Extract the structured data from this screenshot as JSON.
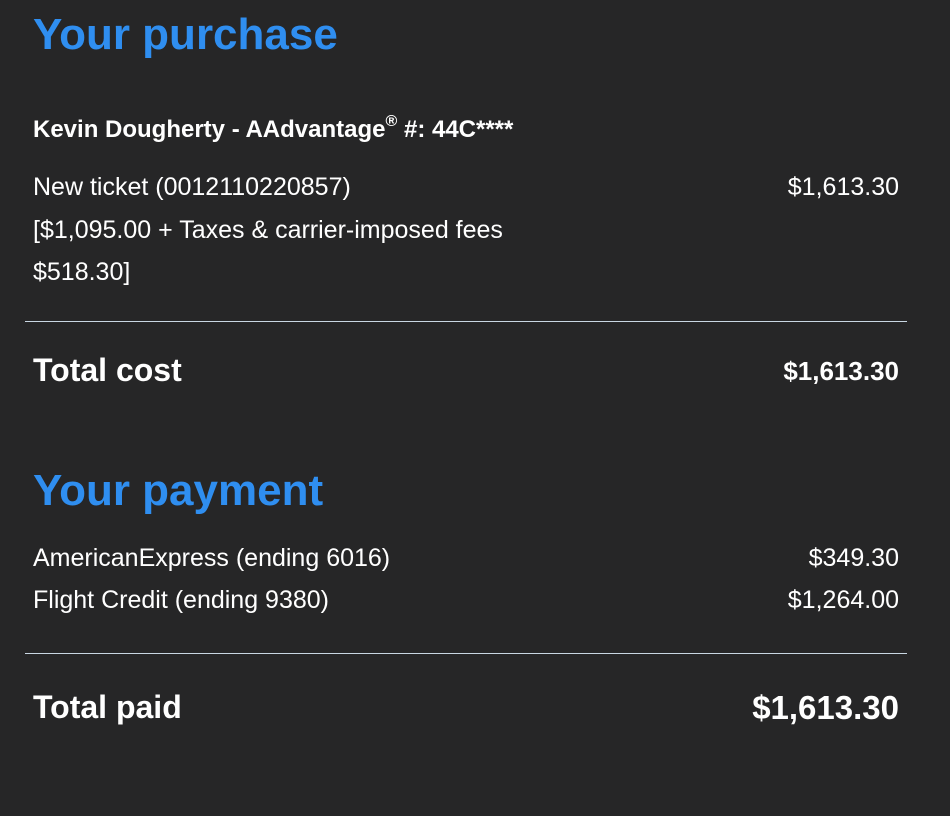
{
  "purchase": {
    "heading": "Your purchase",
    "passenger_prefix": "Kevin Dougherty - AAdvantage",
    "registered_mark": "®",
    "passenger_suffix": " #: 44C****",
    "ticket": {
      "line1": "New ticket (0012110220857)",
      "line2": "[$1,095.00 + Taxes & carrier-imposed fees",
      "line3": "$518.30]",
      "amount": "$1,613.30"
    },
    "total_cost_label": "Total cost",
    "total_cost_amount": "$1,613.30"
  },
  "payment": {
    "heading": "Your payment",
    "rows": [
      {
        "label": "AmericanExpress (ending 6016)",
        "amount": "$349.30"
      },
      {
        "label": "Flight Credit (ending 9380)",
        "amount": "$1,264.00"
      }
    ],
    "total_paid_label": "Total paid",
    "total_paid_amount": "$1,613.30"
  },
  "colors": {
    "background": "#262627",
    "heading_blue": "#2f8ef0",
    "text": "#ffffff",
    "divider": "#c9d7e3"
  }
}
